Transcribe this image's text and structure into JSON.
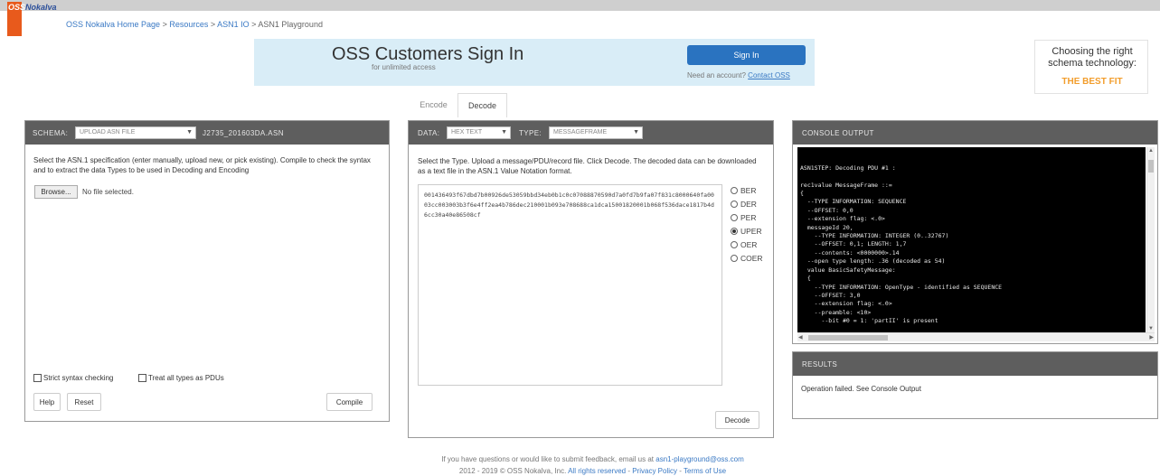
{
  "brand": {
    "oss": "OSS",
    "nokalva": "Nokalva"
  },
  "breadcrumb": {
    "items": [
      "OSS Nokalva Home Page",
      "Resources",
      "ASN1 IO"
    ],
    "separator": " > ",
    "current": "ASN1 Playground"
  },
  "signin": {
    "title": "OSS Customers Sign In",
    "subtitle": "for unlimited access",
    "button": "Sign In",
    "need_text": "Need an account?",
    "contact_link": "Contact OSS"
  },
  "ad": {
    "line1": "Choosing the right schema technology:",
    "line2": "THE BEST FIT"
  },
  "tabs": {
    "encode": "Encode",
    "decode": "Decode"
  },
  "schema_panel": {
    "label": "Schema:",
    "select_value": "Upload ASN file",
    "filename": "J2735_201603DA.ASN",
    "description": "Select the ASN.1 specification (enter manually, upload new, or pick existing). Compile to check the syntax and to extract the data Types to be used in Decoding and Encoding",
    "browse": "Browse...",
    "no_file": "No file selected.",
    "strict": "Strict syntax checking",
    "treat_all": "Treat all types as PDUs",
    "help": "Help",
    "reset": "Reset",
    "compile": "Compile"
  },
  "data_panel": {
    "data_label": "Data:",
    "data_value": "Hex text",
    "type_label": "Type:",
    "type_value": "MessageFrame",
    "description": "Select the Type. Upload a message/PDU/record file. Click Decode. The decoded data can be downloaded as a text file in the ASN.1 Value Notation format.",
    "hex": "001436493f67dbd7b00926de53059bbd34eb0b1c0c07088870590d7a0fd7b9fa07f831c8000640fa0003cc003003b3f6e4ff2ea4b786dec210001b093e708688ca1dca15001820001b068f536dace1817b4d6cc30a40e86508cf",
    "encodings": [
      "BER",
      "DER",
      "PER",
      "UPER",
      "OER",
      "COER"
    ],
    "selected_encoding": "UPER",
    "decode_button": "Decode"
  },
  "console_panel": {
    "title": "Console Output",
    "lines": [
      "ASN1STEP: Decoding PDU #1 :",
      "",
      "rec1value MessageFrame ::=",
      "{",
      "  --TYPE INFORMATION: SEQUENCE",
      "  --OFFSET: 0,0",
      "  --extension flag: <.0>",
      "  messageId 20,",
      "    --TYPE INFORMATION: INTEGER (0..32767)",
      "    --OFFSET: 0,1; LENGTH: 1,7",
      "    --contents: <0000000>.14",
      "  --open type length: .36 (decoded as 54)",
      "  value BasicSafetyMessage:",
      "  {",
      "    --TYPE INFORMATION: OpenType - identified as SEQUENCE",
      "    --OFFSET: 3,0",
      "    --extension flag: <.0>",
      "    --preamble: <10>",
      "      --bit #0 = 1: 'partII' is present"
    ]
  },
  "results_panel": {
    "title": "Results",
    "text": "Operation failed. See Console Output"
  },
  "footer": {
    "line1_text": "If you have questions or would like to submit feedback, email us at",
    "email": "asn1-playground@oss.com",
    "line2_text": "2012 - 2019 © OSS Nokalva, Inc.",
    "rights": "All rights reserved",
    "privacy": "Privacy Policy",
    "terms": "Terms of Use"
  },
  "colors": {
    "accent_blue": "#2a73c0",
    "logo_orange": "#e85a1c",
    "banner_bg": "#d9edf7",
    "panel_header": "#5e5e5e",
    "best_fit_orange": "#f29d2c"
  }
}
